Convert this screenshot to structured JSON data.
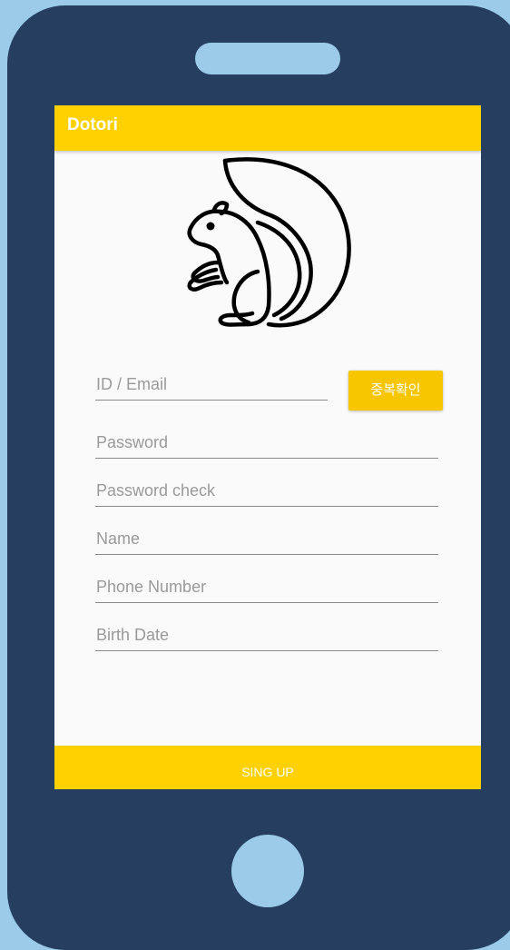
{
  "app": {
    "title": "Dotori"
  },
  "logo": {
    "icon": "squirrel-icon"
  },
  "form": {
    "id_email": {
      "placeholder": "ID / Email",
      "value": ""
    },
    "duplicate_check_label": "중복확인",
    "password": {
      "placeholder": "Password",
      "value": ""
    },
    "password_check": {
      "placeholder": "Password check",
      "value": ""
    },
    "name": {
      "placeholder": "Name",
      "value": ""
    },
    "phone_number": {
      "placeholder": "Phone Number",
      "value": ""
    },
    "birth_date": {
      "placeholder": "Birth Date",
      "value": ""
    }
  },
  "signup": {
    "label": "SING UP"
  },
  "colors": {
    "background": "#9ccbea",
    "phone_body": "#263f60",
    "accent": "#ffd100",
    "screen": "#fafafa"
  }
}
